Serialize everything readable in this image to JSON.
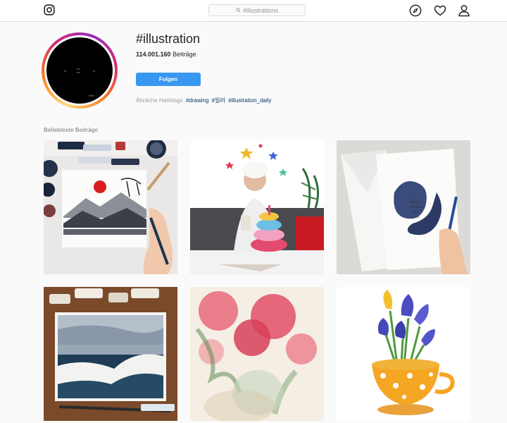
{
  "header": {
    "search_placeholder": "#illustrations",
    "icons": [
      "instagram-logo-icon",
      "search-icon",
      "compass-icon",
      "heart-icon",
      "profile-icon"
    ]
  },
  "profile": {
    "hashtag": "#illustration",
    "post_count": "114.001.160",
    "post_count_label": "Beiträge",
    "follow_label": "Folgen",
    "related_label": "Ähnliche Hashtags",
    "related_tags": [
      "#drawing",
      "#일러",
      "#illustration_daily"
    ]
  },
  "section": {
    "title": "Beliebteste Beiträge"
  },
  "colors": {
    "accent": "#3897f0",
    "link": "#003569",
    "border": "#dbdbdb"
  }
}
